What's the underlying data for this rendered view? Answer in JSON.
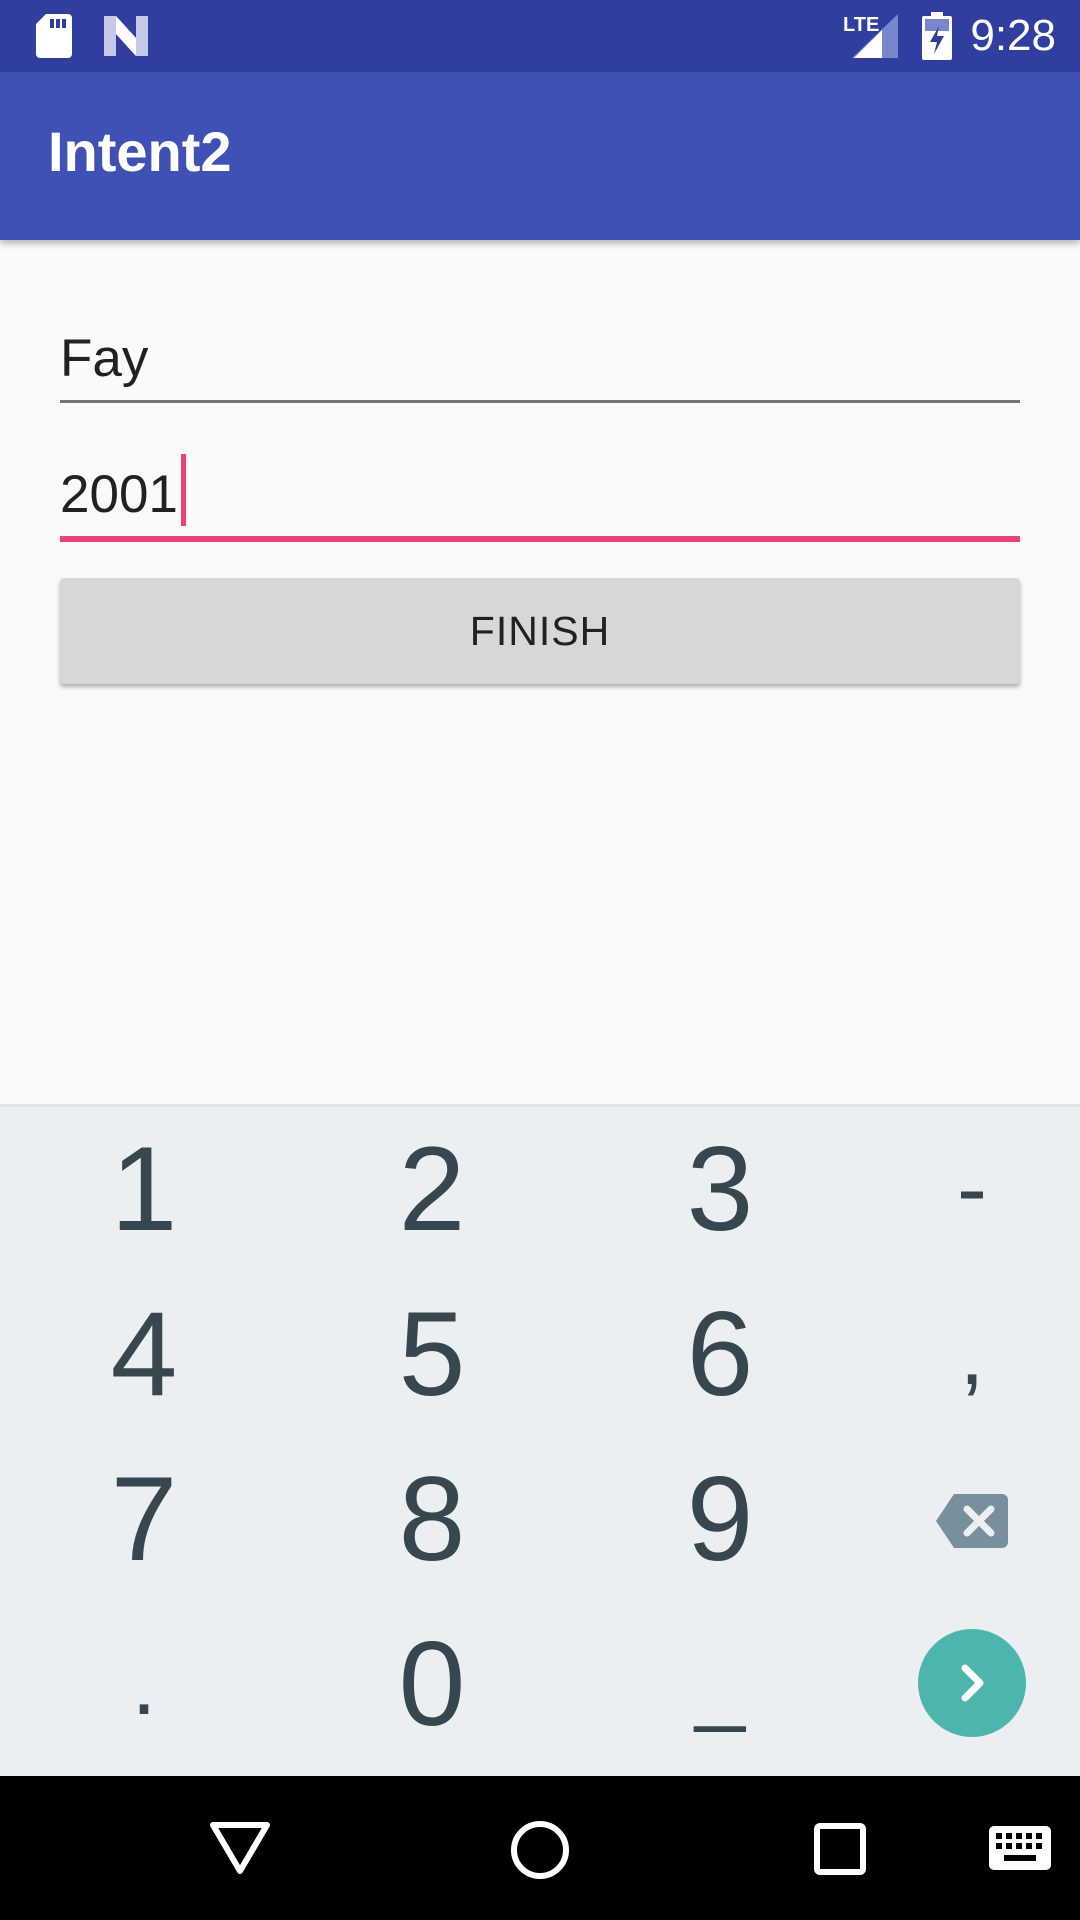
{
  "status_bar": {
    "time": "9:28",
    "network_label": "LTE",
    "icons": [
      "sd-card-icon",
      "n-logo-icon",
      "lte-signal-icon",
      "battery-charging-icon"
    ],
    "background": "#303f9f"
  },
  "app_bar": {
    "title": "Intent2",
    "background": "#3f51b5"
  },
  "form": {
    "name_value": "Fay",
    "year_value": "2001",
    "focused_field": "year",
    "accent": "#ec407a",
    "finish_label": "FINISH"
  },
  "keyboard": {
    "keys": [
      [
        "1",
        "2",
        "3",
        "-"
      ],
      [
        "4",
        "5",
        "6",
        ","
      ],
      [
        "7",
        "8",
        "9",
        "backspace"
      ],
      [
        ".",
        "0",
        "_",
        "go"
      ]
    ],
    "key_icons": {
      "backspace": "backspace-icon",
      "go": "go-arrow-icon"
    },
    "go_color": "#4db6ac"
  },
  "nav_bar": {
    "icons": [
      "back-icon",
      "home-icon",
      "recents-icon",
      "keyboard-switch-icon"
    ]
  }
}
